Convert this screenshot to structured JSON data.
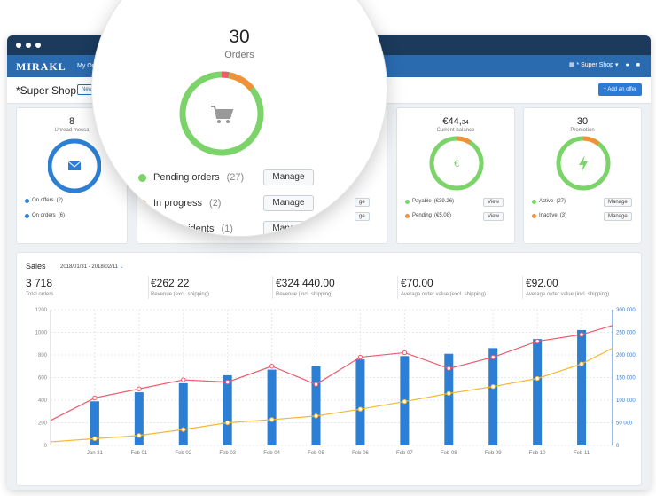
{
  "app": {
    "logo": "MIRAKL",
    "nav_menu": "My Orders",
    "shop_menu": "* Super Shop"
  },
  "header": {
    "shop_title": "*Super Shop",
    "new_badge": "New",
    "add_offer": "+ Add an offer"
  },
  "cards": {
    "messages": {
      "value": "8",
      "label": "Unread messa",
      "items": [
        {
          "label": "On offers",
          "count": "(2)"
        },
        {
          "label": "On orders",
          "count": "(6)"
        }
      ]
    },
    "balance": {
      "value_main": "€44,",
      "value_cents": "34",
      "label": "Current balance",
      "items": [
        {
          "label": "Payable",
          "count": "(€39.26)",
          "button": "View"
        },
        {
          "label": "Pending",
          "count": "(€5.08)",
          "button": "View"
        }
      ]
    },
    "promotion": {
      "value": "30",
      "label": "Promotion",
      "items": [
        {
          "label": "Active",
          "count": "(27)",
          "button": "Manage"
        },
        {
          "label": "Inactive",
          "count": "(3)",
          "button": "Manage"
        }
      ]
    },
    "orders_partial_buttons": [
      "ge",
      "ge"
    ]
  },
  "magnifier": {
    "value": "30",
    "label": "Orders",
    "items": [
      {
        "label": "Pending orders",
        "count": "(27)",
        "button": "Manage",
        "color": "#7bd36a"
      },
      {
        "label": "In progress",
        "count": "(2)",
        "button": "Manage",
        "color": "#f0913a"
      },
      {
        "label": "With incidents",
        "count": "(1)",
        "button": "Manage",
        "color": "#ef5a6b"
      }
    ]
  },
  "sales": {
    "title": "Sales",
    "range": "2018/01/31 - 2018/02/11",
    "stats": [
      {
        "value": "3 718",
        "label": "Total orders"
      },
      {
        "value": "€262 22",
        "label": "Revenue (excl. shipping)"
      },
      {
        "value": "€324 440.00",
        "label": "Revenue (incl. shipping)"
      },
      {
        "value": "€70.00",
        "label": "Average order value (excl. shipping)"
      },
      {
        "value": "€92.00",
        "label": "Average order value (incl. shipping)"
      }
    ]
  },
  "colors": {
    "navy": "#1b3a5c",
    "blue": "#2a6bb0",
    "green": "#7bd36a",
    "orange": "#f0913a",
    "red": "#ef5a6b",
    "bar": "#2d7fd3",
    "yellow": "#f5b82e"
  },
  "chart_data": {
    "type": "bar",
    "categories": [
      "Jan 31",
      "Feb 01",
      "Feb 02",
      "Feb 03",
      "Feb 04",
      "Feb 05",
      "Feb 06",
      "Feb 07",
      "Feb 08",
      "Feb 09",
      "Feb 10",
      "Feb 11"
    ],
    "series": [
      {
        "type": "bar",
        "axis": "left",
        "values": [
          390,
          470,
          550,
          620,
          670,
          700,
          760,
          790,
          810,
          860,
          940,
          1020
        ]
      },
      {
        "type": "line",
        "axis": "right",
        "color": "#ef5a6b",
        "values": [
          105000,
          125000,
          145000,
          140000,
          175000,
          135000,
          195000,
          205000,
          170000,
          195000,
          230000,
          245000
        ]
      },
      {
        "type": "line",
        "axis": "right",
        "color": "#f5b82e",
        "values": [
          15000,
          22000,
          35000,
          50000,
          57000,
          65000,
          80000,
          97000,
          115000,
          130000,
          148000,
          180000
        ]
      }
    ],
    "line_start": {
      "red": 55000,
      "yellow": 8000
    },
    "line_end": {
      "red": 265000,
      "yellow": 215000
    },
    "y_left": {
      "range": [
        0,
        1200
      ],
      "ticks": [
        "0",
        "200",
        "400",
        "600",
        "800",
        "1000",
        "1200"
      ]
    },
    "y_right": {
      "range": [
        0,
        300000
      ],
      "ticks": [
        "0",
        "50 000",
        "100 000",
        "150 000",
        "200 000",
        "250 000",
        "300 000"
      ]
    },
    "grid": true
  },
  "icons": {
    "cart": "cart-icon",
    "envelope": "envelope-icon",
    "euro": "euro-icon",
    "lightning": "lightning-icon"
  }
}
